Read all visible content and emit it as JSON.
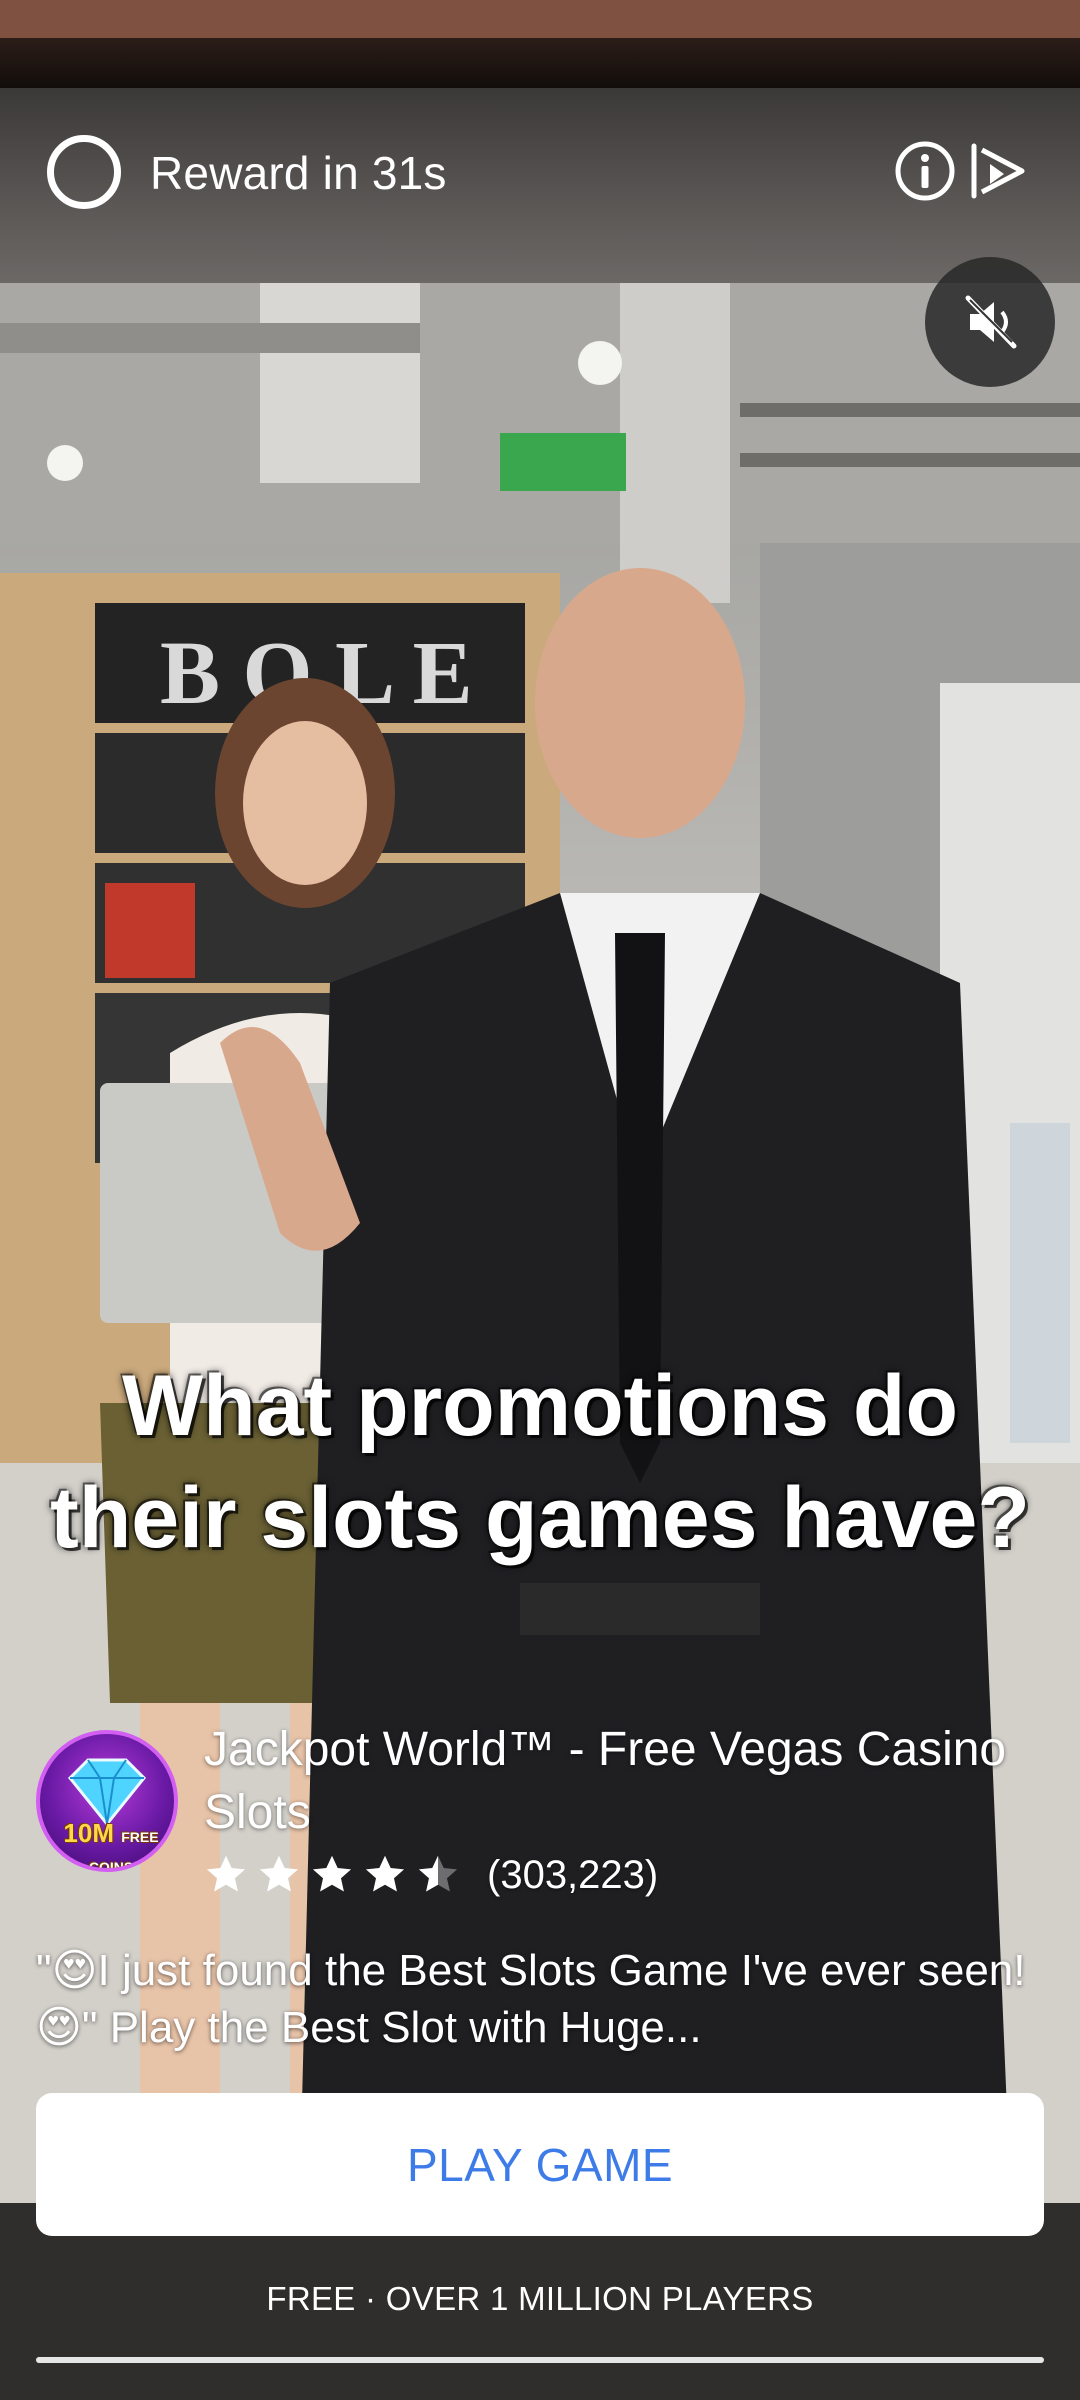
{
  "ad": {
    "reward_label": "Reward in 31s",
    "caption_line1": "What promotions do",
    "caption_line2": "their slots games have?",
    "app": {
      "title": "Jackpot World™ - Free Vegas Casino Slots",
      "icon_text_main": "10M",
      "icon_text_badge": "FREE COINS",
      "rating": 4.5,
      "rating_count": "(303,223)"
    },
    "description": "\"😍I just found the Best Slots Game I've ever seen! 😍\"  Play the Best Slot with Huge...",
    "cta_label": "PLAY GAME",
    "footer_text": "FREE · OVER 1 MILLION PLAYERS",
    "progress": 1.0,
    "icons": {
      "countdown": "countdown-ring-icon",
      "info": "info-icon",
      "skip": "skip-icon",
      "mute": "mute-icon",
      "star": "star-icon"
    },
    "colors": {
      "cta_text": "#3d7ce8",
      "cta_background": "#ffffff",
      "footer_background": "#2f2e2d"
    }
  }
}
